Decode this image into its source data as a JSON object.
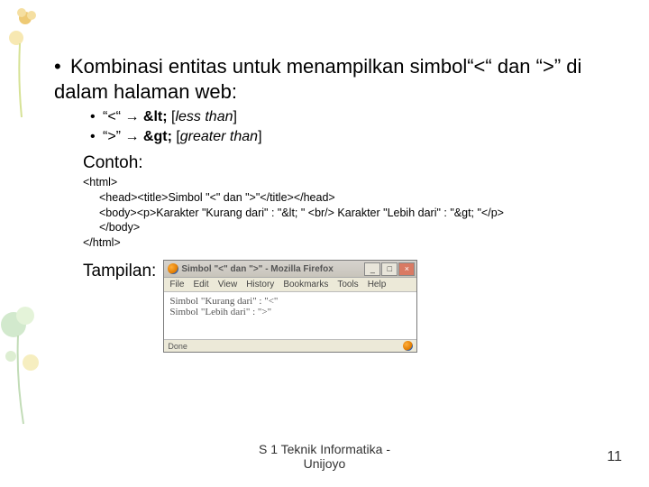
{
  "main_bullet": "Kombinasi entitas untuk menampilkan simbol“<“ dan “>” di dalam halaman web:",
  "sub": [
    {
      "quote": "“<“",
      "arrow": "→",
      "entity": "&lt;",
      "meaning": "less than"
    },
    {
      "quote": "“>”",
      "arrow": "→",
      "entity": "&gt;",
      "meaning": "greater than"
    }
  ],
  "contoh_label": "Contoh:",
  "code": {
    "l1": "<html>",
    "l2": "<head><title>Simbol \"<\" dan \">\"</title></head>",
    "l3": "<body><p>Karakter \"Kurang dari\" : \"&lt; \" <br/> Karakter \"Lebih dari\" : \"&gt; \"</p>",
    "l4": "</body>",
    "l5": "</html>"
  },
  "tampilan_label": "Tampilan:",
  "ff": {
    "title": "Simbol \"<\" dan \">\" - Mozilla Firefox",
    "menu": [
      "File",
      "Edit",
      "View",
      "History",
      "Bookmarks",
      "Tools",
      "Help"
    ],
    "body_line1": "Simbol \"Kurang dari\" : \"<\"",
    "body_line2": "Simbol \"Lebih dari\" : \">\"",
    "status": "Done"
  },
  "footer": "S 1 Teknik Informatika - Unijoyo",
  "page": "11"
}
